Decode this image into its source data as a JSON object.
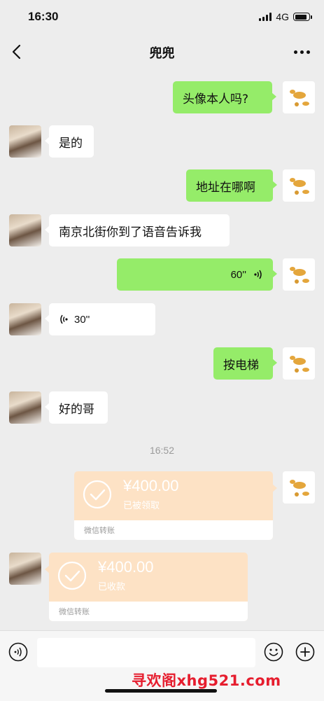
{
  "status_bar": {
    "time": "16:30",
    "network": "4G"
  },
  "nav": {
    "title": "兜兜"
  },
  "messages": [
    {
      "from": "me",
      "text": "头像本人吗?"
    },
    {
      "from": "them",
      "text": "是的"
    },
    {
      "from": "me",
      "text": "地址在哪啊"
    },
    {
      "from": "them",
      "text": "南京北街你到了语音告诉我"
    },
    {
      "from": "me",
      "type": "voice",
      "duration": "60''"
    },
    {
      "from": "them",
      "type": "voice",
      "duration": "30''"
    },
    {
      "from": "me",
      "text": "按电梯"
    },
    {
      "from": "them",
      "text": "好的哥"
    }
  ],
  "timestamp": "16:52",
  "transfers": [
    {
      "from": "me",
      "amount": "¥400.00",
      "status": "已被领取",
      "label": "微信转账"
    },
    {
      "from": "them",
      "amount": "¥400.00",
      "status": "已收款",
      "label": "微信转账"
    }
  ],
  "input": {
    "placeholder": ""
  },
  "watermark": "寻欢阁xhg521.com",
  "colors": {
    "background": "#ededed",
    "my_bubble": "#95ec69",
    "their_bubble": "#ffffff",
    "transfer": "#fde2c5",
    "watermark": "#e61d2e"
  },
  "icons": [
    "back-icon",
    "more-icon",
    "voice-wave-icon",
    "check-circle-icon",
    "voice-toggle-icon",
    "emoji-icon",
    "plus-icon"
  ]
}
